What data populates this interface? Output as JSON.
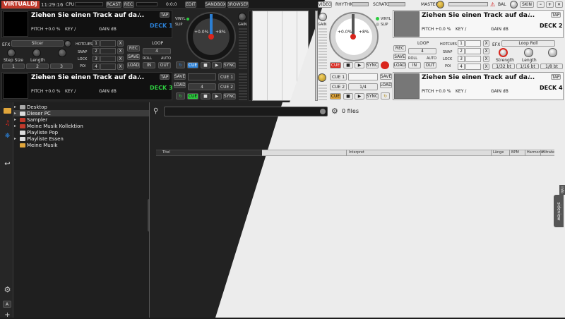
{
  "topbar": {
    "logo": "VIRTUALDJ",
    "clock": "11:29:16",
    "cpu_label": "CPU",
    "rcast_label": "RCAST",
    "rec_label": "REC",
    "version": "0:0:0",
    "edit_label": "EDIT",
    "sandbox_label": "SANDBOX",
    "browser_label": "BROWSER",
    "video_label": "VIDEO",
    "rhythm_label": "RHYTHM",
    "scratch_label": "SCRATCH",
    "master_label": "MASTER",
    "bal_label": "BAL",
    "skin_label": "SKIN"
  },
  "decks": {
    "deck1": {
      "title": "Ziehen Sie einen Track auf da...",
      "sep": "/",
      "tap": "TAP",
      "pitch": "PITCH +0.0 %",
      "key": "KEY /",
      "gain": "GAIN dB",
      "name": "DECK 1"
    },
    "deck2": {
      "title": "Ziehen Sie einen Track auf da...",
      "sep": "/",
      "tap": "TAP",
      "pitch": "PITCH +0.0 %",
      "key": "KEY /",
      "gain": "GAIN dB",
      "name": "DECK 2"
    },
    "deck3": {
      "title": "Ziehen Sie einen Track auf da...",
      "sep": "/",
      "tap": "TAP",
      "pitch": "PITCH +0.0 %",
      "key": "KEY /",
      "gain": "GAIN dB",
      "name": "DECK 3"
    },
    "deck4": {
      "title": "Ziehen Sie einen Track auf da...",
      "sep": "/",
      "tap": "TAP",
      "pitch": "PITCH +0.0 %",
      "key": "KEY /",
      "gain": "GAIN dB",
      "name": "DECK 4"
    }
  },
  "fx_left": {
    "label": "EFX",
    "effect": "Slicer",
    "p1": "Step Size",
    "p2": "Length",
    "b1": "1",
    "b2": "2",
    "b3": "3"
  },
  "fx_right": {
    "label": "EFX",
    "effect": "Loop Roll",
    "p1": "Strength",
    "p2": "Length",
    "b1": "1/32 bt",
    "b2": "1/16 bt",
    "b3": "1/8 bt"
  },
  "deckctl": {
    "hotcues": "HOTCUES",
    "snap": "SNAP",
    "lock": "LOCK",
    "poi": "POI",
    "roll": "ROLL",
    "auto": "AUTO",
    "h1": "1",
    "h2": "2",
    "h3": "3",
    "h4": "4",
    "x": "X",
    "loop": "LOOP",
    "rec": "REC",
    "save": "SAVE",
    "load": "LOAD",
    "in": "IN",
    "out": "OUT",
    "loopval": "4",
    "cue": "CUE",
    "sync": "SYNC",
    "cue1": "CUE 1",
    "cue2": "CUE 2",
    "quarter": "1/4"
  },
  "jog": {
    "vinyl": "VINYL",
    "slip": "SLIP",
    "pitch_val": "+0.0%",
    "pitch_range": "+8%",
    "gain": "GAIN"
  },
  "browser": {
    "tree": [
      "Desktop",
      "Dieser PC",
      "Sampler",
      "Meine Musik Kollektion",
      "Playliste Pop",
      "Playliste Essen",
      "Meine Musik"
    ],
    "files_count": "0 files",
    "columns": [
      "Titel",
      "Interpret",
      "Länge",
      "BPM",
      "Harmonic",
      "Bitrate"
    ],
    "folders_tab": "folders",
    "sideview_tab": "sideview",
    "info_label": "info",
    "a_label": "A"
  },
  "colors": {
    "deck_blue": "#1a73e8",
    "deck_green": "#2ecc40",
    "cue_red": "#d9251c",
    "folder_red": "#c0392b",
    "folder_yellow": "#e1a63b",
    "jog_blue": "#2b7fd4"
  }
}
